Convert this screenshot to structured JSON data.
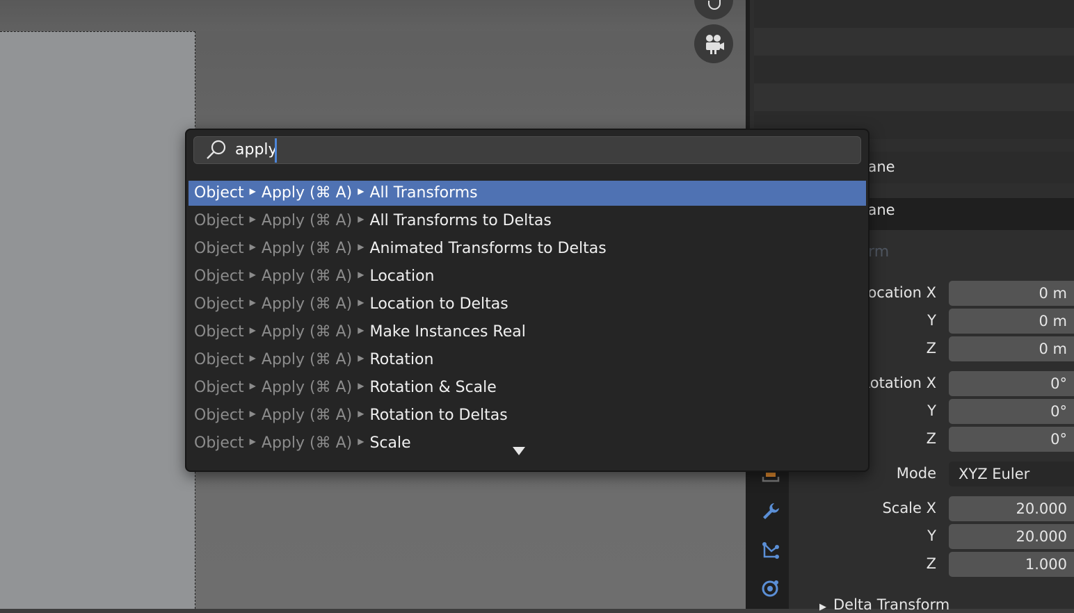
{
  "search": {
    "query": "apply"
  },
  "results": [
    {
      "path": [
        "Object",
        "Apply (⌘ A)"
      ],
      "leaf": "All Transforms",
      "selected": true
    },
    {
      "path": [
        "Object",
        "Apply (⌘ A)"
      ],
      "leaf": "All Transforms to Deltas"
    },
    {
      "path": [
        "Object",
        "Apply (⌘ A)"
      ],
      "leaf": "Animated Transforms to Deltas"
    },
    {
      "path": [
        "Object",
        "Apply (⌘ A)"
      ],
      "leaf": "Location"
    },
    {
      "path": [
        "Object",
        "Apply (⌘ A)"
      ],
      "leaf": "Location to Deltas"
    },
    {
      "path": [
        "Object",
        "Apply (⌘ A)"
      ],
      "leaf": "Make Instances Real"
    },
    {
      "path": [
        "Object",
        "Apply (⌘ A)"
      ],
      "leaf": "Rotation"
    },
    {
      "path": [
        "Object",
        "Apply (⌘ A)"
      ],
      "leaf": "Rotation & Scale"
    },
    {
      "path": [
        "Object",
        "Apply (⌘ A)"
      ],
      "leaf": "Rotation to Deltas"
    },
    {
      "path": [
        "Object",
        "Apply (⌘ A)"
      ],
      "leaf": "Scale"
    }
  ],
  "properties": {
    "object_name": "Plane",
    "data_name": "Plane",
    "panel_title": "Transform",
    "location": {
      "label_x": "Location X",
      "label_y": "Y",
      "label_z": "Z",
      "x": "0 m",
      "y": "0 m",
      "z": "0 m"
    },
    "rotation": {
      "label_x": "Rotation X",
      "label_y": "Y",
      "label_z": "Z",
      "x": "0°",
      "y": "0°",
      "z": "0°"
    },
    "mode": {
      "label": "Mode",
      "value": "XYZ Euler"
    },
    "scale": {
      "label_x": "Scale X",
      "label_y": "Y",
      "label_z": "Z",
      "x": "20.000",
      "y": "20.000",
      "z": "1.000"
    },
    "delta_panel": "Delta Transform"
  },
  "colors": {
    "selection": "#4f72b3",
    "cursor": "#4d86d9",
    "popup_bg": "#252525"
  },
  "icons": [
    "hand-icon",
    "camera-icon",
    "search-icon",
    "tool-icon",
    "render-icon",
    "output-icon",
    "view-layer-icon",
    "scene-icon",
    "world-icon",
    "object-icon",
    "modifier-icon",
    "particles-icon",
    "physics-icon"
  ]
}
